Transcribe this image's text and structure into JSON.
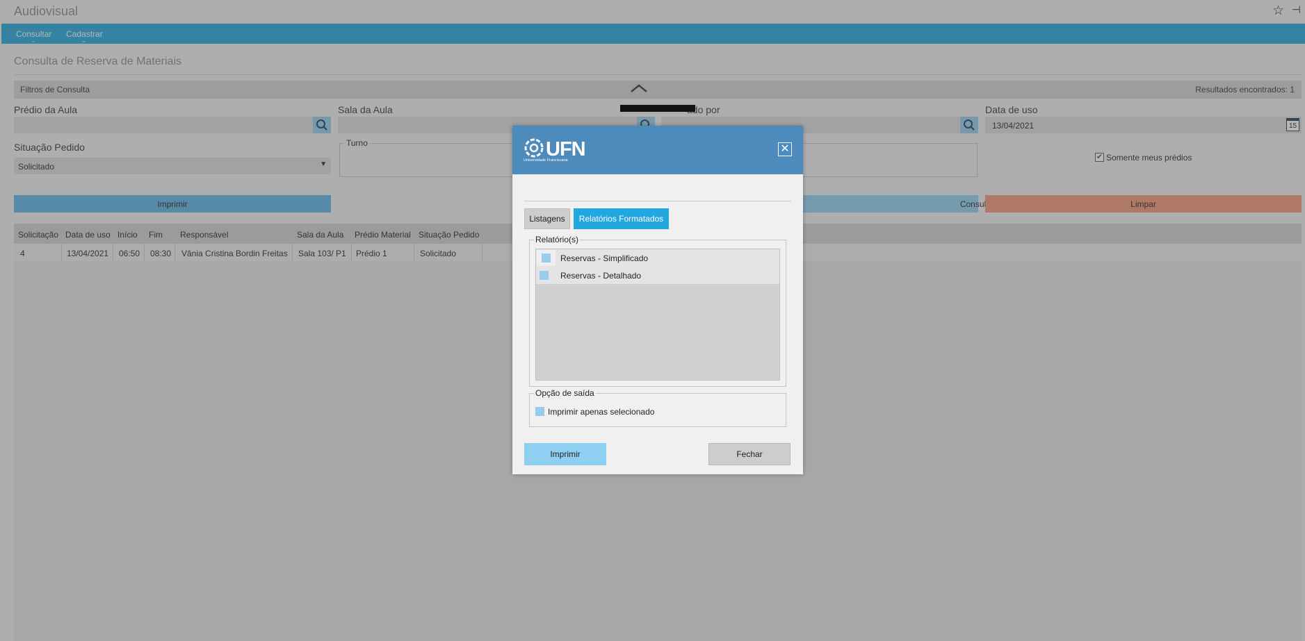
{
  "app": {
    "title": "Audiovisual",
    "menu": [
      {
        "label": "Consultar"
      },
      {
        "label": "Cadastrar"
      }
    ]
  },
  "page": {
    "title": "Consulta de Reserva de Materiais",
    "filters_label": "Filtros de Consulta",
    "results_label": "Resultados encontrados: 1"
  },
  "form": {
    "predio_label": "Prédio da Aula",
    "sala_label": "Sala da Aula",
    "reservado_label": "ado por",
    "data_label": "Data de uso",
    "data_value": "13/04/2021",
    "calendar_day": "15",
    "situacao_label": "Situação Pedido",
    "situacao_value": "Solicitado",
    "turno_label": "Turno",
    "somente_label": "Somente meus prédios",
    "imprimir_label": "Imprimir",
    "consultar_label": "Consultar",
    "limpar_label": "Limpar"
  },
  "table": {
    "headers": [
      "Solicitação",
      "Data de uso",
      "Início",
      "Fim",
      "Responsável",
      "Sala da Aula",
      "Prédio Material",
      "Situação Pedido"
    ],
    "rows": [
      [
        "4",
        "13/04/2021",
        "06:50",
        "08:30",
        "Vânia Cristina Bordin Freitas",
        "Sala 103/ P1",
        "Prédio 1",
        "Solicitado"
      ]
    ]
  },
  "modal": {
    "logo_text": "UFN",
    "logo_sub": "Universidade Franciscana",
    "tabs": [
      {
        "label": "Listagens"
      },
      {
        "label": "Relatórios Formatados"
      }
    ],
    "reports_legend": "Relatório(s)",
    "reports": [
      {
        "label": "Reservas - Simplificado"
      },
      {
        "label": "Reservas - Detalhado"
      }
    ],
    "output_legend": "Opção de saída",
    "output_option": "Imprimir apenas selecionado",
    "imprimir_label": "Imprimir",
    "fechar_label": "Fechar"
  },
  "colors": {
    "accent": "#22a7df",
    "modal_header": "#4d8bbd",
    "print_button": "#5ab4e6",
    "consult_button": "#8fd0f2",
    "clear_button": "#f59578"
  }
}
